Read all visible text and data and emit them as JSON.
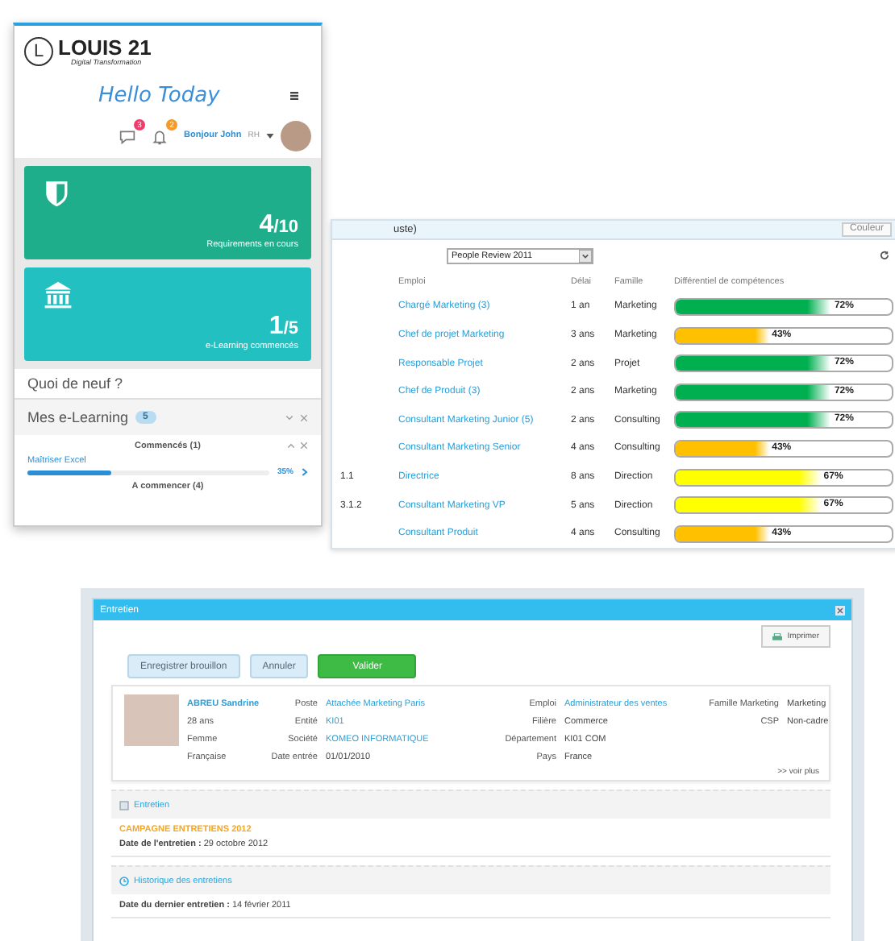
{
  "competency_table": {
    "title_fragment": "uste)",
    "color_button": "Couleur",
    "review_select": "People Review 2011",
    "columns": [
      "Emploi",
      "Délai",
      "Famille",
      "Différentiel de compétences"
    ],
    "rows": [
      {
        "job": "Chargé Marketing (3)",
        "delay": "1 an",
        "family": "Marketing",
        "level": 0.72,
        "reading": "72%",
        "color": "#00b050"
      },
      {
        "job": "Chef de projet Marketing",
        "delay": "3 ans",
        "family": "Marketing",
        "level": 0.43,
        "reading": "43%",
        "color": "#ffc000"
      },
      {
        "job": "Responsable Projet",
        "delay": "2 ans",
        "family": "Projet",
        "level": 0.72,
        "reading": "72%",
        "color": "#00b050"
      },
      {
        "job": "Chef de Produit (3)",
        "delay": "2 ans",
        "family": "Marketing",
        "level": 0.72,
        "reading": "72%",
        "color": "#00b050"
      },
      {
        "job": "Consultant Marketing Junior (5)",
        "delay": "2 ans",
        "family": "Consulting",
        "level": 0.72,
        "reading": "72%",
        "color": "#00b050"
      },
      {
        "job": "Consultant Marketing Senior",
        "delay": "4 ans",
        "family": "Consulting",
        "level": 0.43,
        "reading": "43%",
        "color": "#ffc000"
      },
      {
        "column_1": "1.1",
        "job": "Directrice",
        "delay": "8 ans",
        "family": "Direction",
        "level": 0.67,
        "reading": "67%",
        "color": "#ffff00"
      },
      {
        "column_1": "3.1.2",
        "job": "Consultant Marketing VP",
        "delay": "5 ans",
        "family": "Direction",
        "level": 0.67,
        "reading": "67%",
        "color": "#ffff00"
      },
      {
        "job": "Consultant Produit",
        "delay": "4 ans",
        "family": "Consulting",
        "level": 0.43,
        "reading": "43%",
        "color": "#ffc000"
      }
    ]
  },
  "phone": {
    "logo": {
      "letter": "L",
      "title": "LOUIS 21",
      "tagline": "Digital Transformation"
    },
    "greeting": "Hello Today",
    "user_bar": {
      "chat_badge": "3",
      "bell_badge": "2",
      "greeting": "Bonjour John",
      "role": "RH"
    },
    "stat_cards": [
      {
        "kind": "shield",
        "value": "4",
        "total": "/10",
        "label": "Requirements en cours"
      },
      {
        "kind": "bank",
        "value": "1",
        "total": "/5",
        "label": "e-Learning commencés"
      }
    ],
    "news_title": "Quoi de neuf ?",
    "elearning": {
      "title": "Mes e-Learning",
      "count": "5",
      "groups": [
        {
          "title": "Commencés (1)",
          "expanded": true,
          "courses": [
            {
              "name": "Maîtriser Excel",
              "level": 0.35,
              "reading": "35%"
            }
          ]
        },
        {
          "title": "A commencer (4)",
          "expanded": false
        }
      ]
    }
  },
  "interview_window": {
    "title": "Entretien",
    "print_button": "Imprimer",
    "actions": [
      {
        "label": "Enregistrer brouillon",
        "kind": "secondary"
      },
      {
        "label": "Annuler",
        "kind": "secondary"
      },
      {
        "label": "Valider",
        "kind": "primary"
      }
    ],
    "employee": {
      "name": "ABREU Sandrine",
      "details": [
        "28 ans",
        "Femme",
        "Française"
      ],
      "field_columns": [
        [
          {
            "label": "Poste",
            "value": "Attachée Marketing Paris",
            "link": true
          },
          {
            "label": "Entité",
            "value": "KI01",
            "link": true
          },
          {
            "label": "Société",
            "value": "KOMEO INFORMATIQUE",
            "link": true
          },
          {
            "label": "Date entrée",
            "value": "01/01/2010",
            "link": false
          }
        ],
        [
          {
            "label": "Emploi",
            "value": "Administrateur des ventes",
            "link": true
          },
          {
            "label": "Filière",
            "value": "Commerce",
            "link": false
          },
          {
            "label": "Département",
            "value": "KI01 COM",
            "link": false
          },
          {
            "label": "Pays",
            "value": "France",
            "link": false
          }
        ],
        [
          {
            "label": "Famille Marketing",
            "value": "Marketing",
            "link": false
          },
          {
            "label": "CSP",
            "value": "Non-cadre",
            "link": false
          }
        ]
      ],
      "more_link": ">> voir plus"
    },
    "sections": [
      {
        "kind": "checklist",
        "title": "Entretien",
        "campaign": "CAMPAGNE ENTRETIENS 2012",
        "lines": [
          "**Date de l'entretien :** 29 octobre 2012"
        ]
      },
      {
        "kind": "history",
        "title": "Historique des entretiens",
        "lines": [
          "**Date du dernier entretien :** 14 février 2011"
        ]
      }
    ]
  }
}
